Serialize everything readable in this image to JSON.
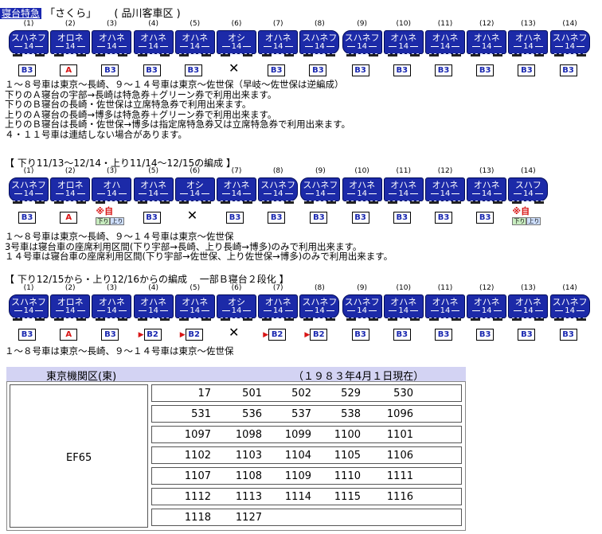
{
  "header": {
    "badge": "寝台特急",
    "name": "「さくら」",
    "depot": "( 品川客車区 )"
  },
  "train1": [
    {
      "n": "(1)",
      "name": "スハネフ",
      "cls": "14",
      "icon": "b3"
    },
    {
      "n": "(2)",
      "name": "オロネ",
      "cls": "14",
      "icon": "a"
    },
    {
      "n": "(3)",
      "name": "オハネ",
      "cls": "14",
      "icon": "b3"
    },
    {
      "n": "(4)",
      "name": "オハネ",
      "cls": "14",
      "icon": "b3"
    },
    {
      "n": "(5)",
      "name": "オハネ",
      "cls": "14",
      "icon": "b3"
    },
    {
      "n": "(6)",
      "name": "オシ",
      "cls": "14",
      "icon": "dining"
    },
    {
      "n": "(7)",
      "name": "オハネ",
      "cls": "14",
      "icon": "b3"
    },
    {
      "n": "(8)",
      "name": "スハネフ",
      "cls": "14",
      "icon": "b3"
    },
    {
      "n": "(9)",
      "name": "スハネフ",
      "cls": "14",
      "icon": "b3"
    },
    {
      "n": "(10)",
      "name": "オハネ",
      "cls": "14",
      "icon": "b3"
    },
    {
      "n": "(11)",
      "name": "オハネ",
      "cls": "14",
      "icon": "b3"
    },
    {
      "n": "(12)",
      "name": "オハネ",
      "cls": "14",
      "icon": "b3"
    },
    {
      "n": "(13)",
      "name": "オハネ",
      "cls": "14",
      "icon": "b3"
    },
    {
      "n": "(14)",
      "name": "スハネフ",
      "cls": "14",
      "icon": "b3"
    }
  ],
  "notes1": [
    "１～８号車は東京～長崎、９～１４号車は東京～佐世保（早岐～佐世保は逆編成）",
    "下りのＡ寝台の宇部→長崎は特急券＋グリーン券で利用出来ます。",
    "下りのＢ寝台の長崎・佐世保は立席特急券で利用出来ます。",
    "上りのＡ寝台の長崎→博多は特急券＋グリーン券で利用出来ます。",
    "上りのＢ寝台は長崎・佐世保→博多は指定席特急券又は立席特急券で利用出来ます。",
    "４・１１号車は連結しない場合があります。"
  ],
  "section2": "【 下り11/13～12/14・上り11/14～12/15の編成 】",
  "train2": [
    {
      "n": "(1)",
      "name": "スハネフ",
      "cls": "14",
      "icon": "b3"
    },
    {
      "n": "(2)",
      "name": "オロネ",
      "cls": "14",
      "icon": "a"
    },
    {
      "n": "(3)",
      "name": "オハ",
      "cls": "14",
      "icon": "jiyu"
    },
    {
      "n": "(5)",
      "name": "オハネ",
      "cls": "14",
      "icon": "b3"
    },
    {
      "n": "(6)",
      "name": "オシ",
      "cls": "14",
      "icon": "dining"
    },
    {
      "n": "(7)",
      "name": "オハネ",
      "cls": "14",
      "icon": "b3"
    },
    {
      "n": "(8)",
      "name": "スハネフ",
      "cls": "14",
      "icon": "b3"
    },
    {
      "n": "(9)",
      "name": "スハネフ",
      "cls": "14",
      "icon": "b3"
    },
    {
      "n": "(10)",
      "name": "オハネ",
      "cls": "14",
      "icon": "b3"
    },
    {
      "n": "(11)",
      "name": "オハネ",
      "cls": "14",
      "icon": "b3"
    },
    {
      "n": "(12)",
      "name": "オハネ",
      "cls": "14",
      "icon": "b3"
    },
    {
      "n": "(13)",
      "name": "オハネ",
      "cls": "14",
      "icon": "b3"
    },
    {
      "n": "(14)",
      "name": "スハフ",
      "cls": "14",
      "icon": "jiyu"
    }
  ],
  "jiyu": {
    "mark": "※自",
    "down": "下り",
    "up": "上り"
  },
  "notes2": [
    "１～８号車は東京～長崎、９～１４号車は東京～佐世保",
    "3号車は寝台車の座席利用区間(下り宇部→長崎、上り長崎→博多)のみで利用出来ます。",
    "１４号車は寝台車の座席利用区間(下り宇部→佐世保、上り佐世保→博多)のみで利用出来ます。"
  ],
  "section3": "【 下り12/15から・上り12/16からの編成　 一部Ｂ寝台２段化 】",
  "train3": [
    {
      "n": "(1)",
      "name": "スハネフ",
      "cls": "14",
      "icon": "b3"
    },
    {
      "n": "(2)",
      "name": "オロネ",
      "cls": "14",
      "icon": "a"
    },
    {
      "n": "(3)",
      "name": "オハネ",
      "cls": "14",
      "icon": "b3"
    },
    {
      "n": "(4)",
      "name": "オハネ",
      "cls": "14",
      "icon": "b2"
    },
    {
      "n": "(5)",
      "name": "オハネ",
      "cls": "14",
      "icon": "b2"
    },
    {
      "n": "(6)",
      "name": "オシ",
      "cls": "14",
      "icon": "dining"
    },
    {
      "n": "(7)",
      "name": "オハネ",
      "cls": "14",
      "icon": "b2"
    },
    {
      "n": "(8)",
      "name": "スハネフ",
      "cls": "14",
      "icon": "b2"
    },
    {
      "n": "(9)",
      "name": "スハネフ",
      "cls": "14",
      "icon": "b3"
    },
    {
      "n": "(10)",
      "name": "オハネ",
      "cls": "14",
      "icon": "b3"
    },
    {
      "n": "(11)",
      "name": "オハネ",
      "cls": "14",
      "icon": "b3"
    },
    {
      "n": "(12)",
      "name": "オハネ",
      "cls": "14",
      "icon": "b3"
    },
    {
      "n": "(13)",
      "name": "オハネ",
      "cls": "14",
      "icon": "b3"
    },
    {
      "n": "(14)",
      "name": "スハネフ",
      "cls": "14",
      "icon": "b3"
    }
  ],
  "notes3": [
    "１～８号車は東京～長崎、９～１４号車は東京～佐世保"
  ],
  "labels": {
    "b3": "B3",
    "b2": "B2",
    "a": "A"
  },
  "depot": {
    "name": "東京機関区(東)",
    "date": "（１９８３年4月１日現在）",
    "class": "EF65"
  },
  "locos": [
    [
      "17",
      "501",
      "502",
      "529",
      "530"
    ],
    [
      "531",
      "536",
      "537",
      "538",
      "1096"
    ],
    [
      "1097",
      "1098",
      "1099",
      "1100",
      "1101"
    ],
    [
      "1102",
      "1103",
      "1104",
      "1105",
      "1106"
    ],
    [
      "1107",
      "1108",
      "1109",
      "1110",
      "1111"
    ],
    [
      "1112",
      "1113",
      "1114",
      "1115",
      "1116"
    ],
    [
      "1118",
      "1127"
    ]
  ],
  "colors": {
    "car": "#1c2aa8",
    "accent_red": "#d81515",
    "depot_bar": "#d3d3f3"
  }
}
